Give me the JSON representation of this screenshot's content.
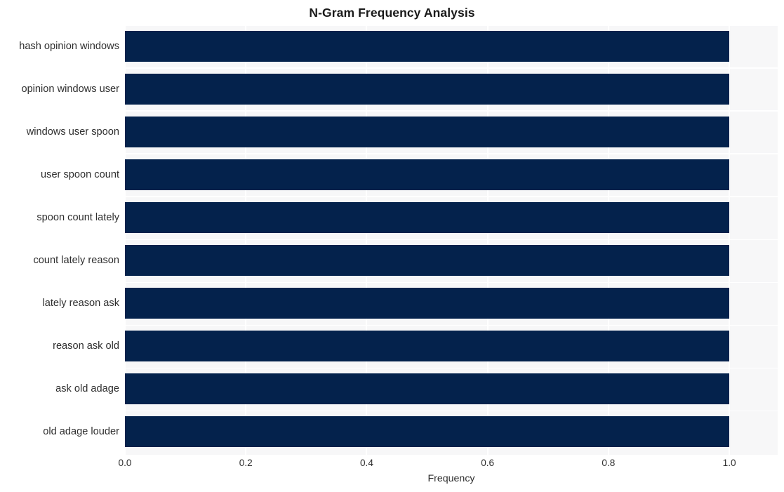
{
  "chart_data": {
    "type": "bar",
    "orientation": "horizontal",
    "title": "N-Gram Frequency Analysis",
    "xlabel": "Frequency",
    "ylabel": "",
    "categories": [
      "hash opinion windows",
      "opinion windows user",
      "windows user spoon",
      "user spoon count",
      "spoon count lately",
      "count lately reason",
      "lately reason ask",
      "reason ask old",
      "ask old adage",
      "old adage louder"
    ],
    "values": [
      1.0,
      1.0,
      1.0,
      1.0,
      1.0,
      1.0,
      1.0,
      1.0,
      1.0,
      1.0
    ],
    "xlim": [
      0.0,
      1.08
    ],
    "xticks": [
      0.0,
      0.2,
      0.4,
      0.6,
      0.8,
      1.0
    ],
    "xtick_labels": [
      "0.0",
      "0.2",
      "0.4",
      "0.6",
      "0.8",
      "1.0"
    ],
    "grid": true,
    "legend": null,
    "bar_color": "#04224c",
    "plot_background": "#f7f7f8",
    "figure_background": "#ffffff",
    "gridline_color": "#ffffff",
    "text_color": "#2e2e2e",
    "title_color": "#1a1a1a"
  }
}
